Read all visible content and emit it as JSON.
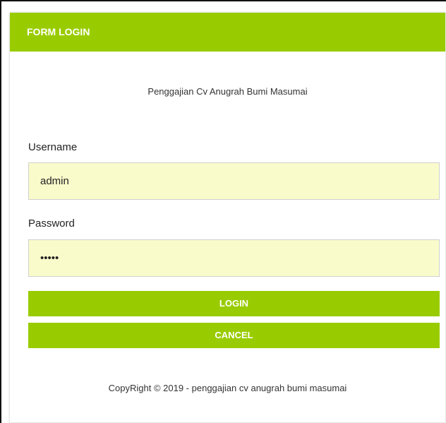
{
  "header": {
    "title": "FORM LOGIN"
  },
  "subtitle": "Penggajian Cv Anugrah Bumi Masumai",
  "form": {
    "username_label": "Username",
    "username_value": "admin",
    "password_label": "Password",
    "password_value": "admin",
    "login_label": "LOGIN",
    "cancel_label": "CANCEL"
  },
  "footer": {
    "copyright": "CopyRight © 2019 - penggajian cv anugrah bumi masumai"
  },
  "colors": {
    "accent": "#99cc00",
    "input_background": "#fafbcb"
  }
}
